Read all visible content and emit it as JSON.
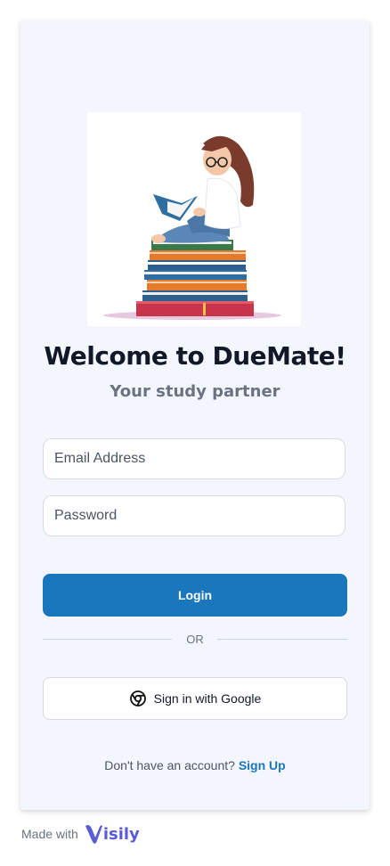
{
  "welcome": {
    "title": "Welcome to DueMate!",
    "subtitle": "Your study partner"
  },
  "form": {
    "email_placeholder": "Email Address",
    "password_placeholder": "Password",
    "login_label": "Login",
    "or_label": "OR",
    "google_label": "Sign in with Google"
  },
  "signup": {
    "prompt": "Don't have an account?",
    "link_label": "Sign Up"
  },
  "footer": {
    "made_with": "Made with",
    "brand_rest": "isily"
  },
  "colors": {
    "accent": "#1a76bd",
    "card_bg": "#f3f7fd",
    "brand": "#5b5bd6"
  },
  "icons": {
    "google": "google-icon",
    "hero": "student-reading-illustration",
    "brand": "visily-logo"
  }
}
